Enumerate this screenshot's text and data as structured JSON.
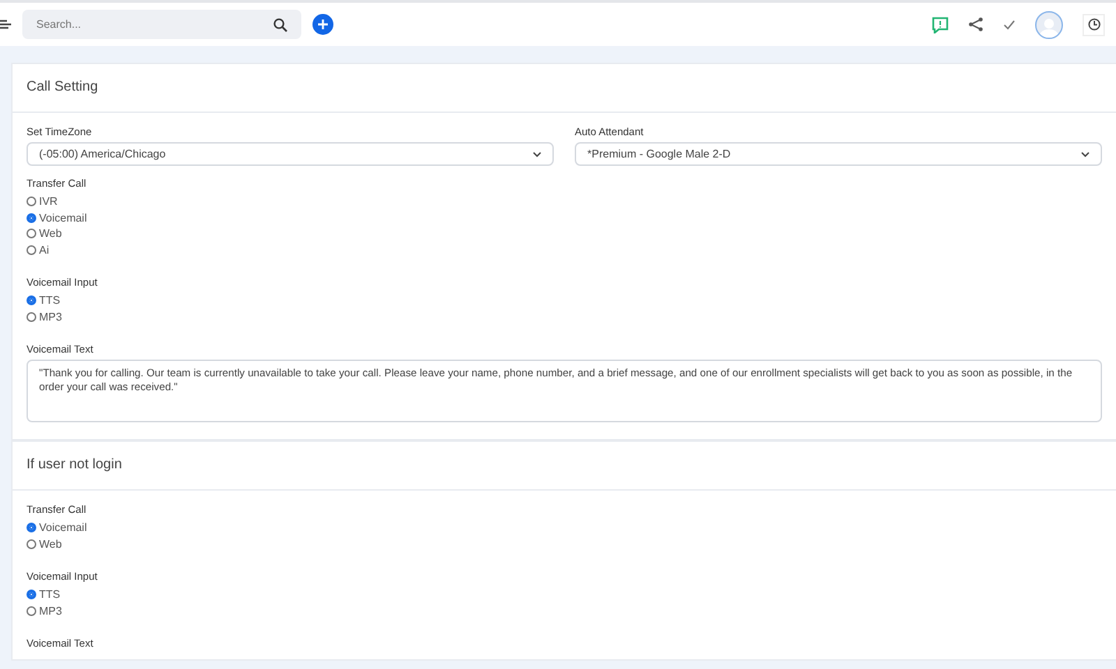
{
  "topbar": {
    "search": {
      "placeholder": "Search..."
    }
  },
  "sections": [
    {
      "title": "Call Setting",
      "fields": [
        {
          "kind": "select_row",
          "items": [
            {
              "label": "Set TimeZone",
              "value": "(-05:00) America/Chicago"
            },
            {
              "label": "Auto Attendant",
              "value": "*Premium - Google Male 2-D"
            }
          ]
        },
        {
          "kind": "radio",
          "label": "Transfer Call",
          "options": [
            {
              "label": "IVR",
              "selected": false
            },
            {
              "label": "Voicemail",
              "selected": true
            },
            {
              "label": "Web",
              "selected": false
            },
            {
              "label": "Ai",
              "selected": false
            }
          ]
        },
        {
          "kind": "radio",
          "label": "Voicemail Input",
          "options": [
            {
              "label": "TTS",
              "selected": true
            },
            {
              "label": "MP3",
              "selected": false
            }
          ]
        },
        {
          "kind": "textarea",
          "label": "Voicemail Text",
          "value": "\"Thank you for calling. Our team is currently unavailable to take your call. Please leave your name, phone number, and a brief message, and one of our enrollment specialists will get back to you as soon as possible, in the order your call was received.\""
        }
      ]
    },
    {
      "title": "If user not login",
      "fields": [
        {
          "kind": "radio",
          "label": "Transfer Call",
          "options": [
            {
              "label": "Voicemail",
              "selected": true
            },
            {
              "label": "Web",
              "selected": false
            }
          ]
        },
        {
          "kind": "radio",
          "label": "Voicemail Input",
          "options": [
            {
              "label": "TTS",
              "selected": true
            },
            {
              "label": "MP3",
              "selected": false
            }
          ]
        },
        {
          "kind": "label",
          "label": "Voicemail Text"
        }
      ]
    }
  ]
}
